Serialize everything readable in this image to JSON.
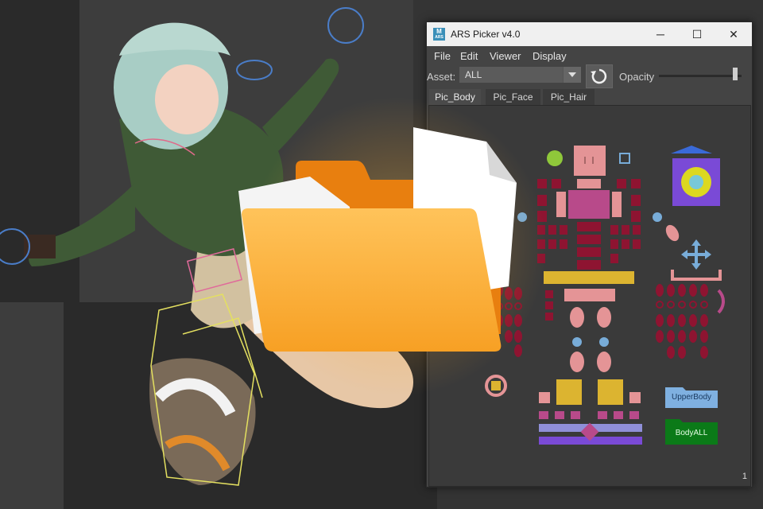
{
  "window": {
    "title": "ARS Picker v4.0",
    "icon_letter": "M",
    "icon_sub": "ARS",
    "minimize_glyph": "─",
    "maximize_glyph": "☐",
    "close_glyph": "✕"
  },
  "menu": [
    "File",
    "Edit",
    "Viewer",
    "Display"
  ],
  "asset": {
    "label": "Asset:",
    "value": "ALL"
  },
  "opacity": {
    "label": "Opacity",
    "value": 0.95
  },
  "tabs": [
    "Pic_Body",
    "Pic_Face",
    "Pic_Hair"
  ],
  "active_tab": "Pic_Body",
  "buttons": {
    "upper_body": "UpperBody",
    "body_all": "BodyALL"
  },
  "page_number": "1",
  "icons": [
    "refresh-icon",
    "move-arrows-icon",
    "folder-icon",
    "dropdown-arrow-icon"
  ],
  "colors": {
    "pink": "#e49496",
    "magenta": "#b84a8a",
    "crimson": "#8e1431",
    "mustard": "#dcb430",
    "light_blue": "#78acd8",
    "lime": "#8fc83a",
    "purple": "#7a4ad6",
    "folder_orange": "#f7a024",
    "upper_body_bg": "#7fb0e0",
    "body_all_bg": "#0b7a18"
  }
}
